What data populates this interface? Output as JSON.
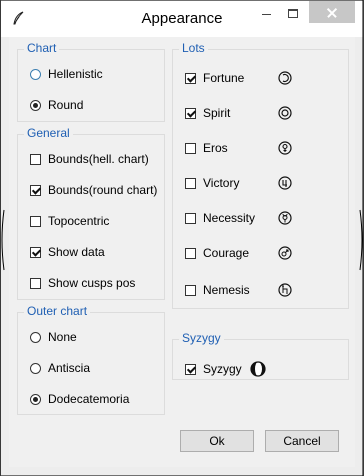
{
  "window": {
    "title": "Appearance"
  },
  "chart": {
    "legend": "Chart",
    "options": [
      "Hellenistic",
      "Round"
    ],
    "selected": "Round"
  },
  "general": {
    "legend": "General",
    "items": [
      {
        "label": "Bounds(hell. chart)",
        "checked": false
      },
      {
        "label": "Bounds(round chart)",
        "checked": true
      },
      {
        "label": "Topocentric",
        "checked": false
      },
      {
        "label": "Show data",
        "checked": true
      },
      {
        "label": "Show cusps pos",
        "checked": false
      }
    ]
  },
  "outer_chart": {
    "legend": "Outer chart",
    "options": [
      "None",
      "Antiscia",
      "Dodecatemoria"
    ],
    "selected": "Dodecatemoria"
  },
  "lots": {
    "legend": "Lots",
    "items": [
      {
        "label": "Fortune",
        "checked": true,
        "icon": "fortune-glyph-icon"
      },
      {
        "label": "Spirit",
        "checked": true,
        "icon": "spirit-glyph-icon"
      },
      {
        "label": "Eros",
        "checked": false,
        "icon": "eros-glyph-icon"
      },
      {
        "label": "Victory",
        "checked": false,
        "icon": "victory-glyph-icon"
      },
      {
        "label": "Necessity",
        "checked": false,
        "icon": "necessity-glyph-icon"
      },
      {
        "label": "Courage",
        "checked": false,
        "icon": "courage-glyph-icon"
      },
      {
        "label": "Nemesis",
        "checked": false,
        "icon": "nemesis-glyph-icon"
      }
    ]
  },
  "syzygy": {
    "legend": "Syzygy",
    "items": [
      {
        "label": "Syzygy",
        "checked": true,
        "icon": "syzygy-moon-icon"
      }
    ]
  },
  "buttons": {
    "ok": "Ok",
    "cancel": "Cancel"
  }
}
